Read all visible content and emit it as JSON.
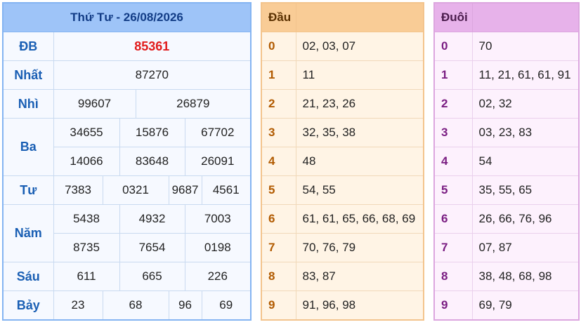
{
  "results": {
    "title": "Thứ Tư - 26/08/2026",
    "prizes": [
      {
        "label": "ĐB",
        "numbers": [
          "85361"
        ]
      },
      {
        "label": "Nhất",
        "numbers": [
          "87270"
        ]
      },
      {
        "label": "Nhì",
        "numbers": [
          "99607",
          "26879"
        ]
      },
      {
        "label": "Ba",
        "numbers": [
          "34655",
          "15876",
          "67702",
          "14066",
          "83648",
          "26091"
        ]
      },
      {
        "label": "Tư",
        "numbers": [
          "7383",
          "0321",
          "9687",
          "4561"
        ]
      },
      {
        "label": "Năm",
        "numbers": [
          "5438",
          "4932",
          "7003",
          "8735",
          "7654",
          "0198"
        ]
      },
      {
        "label": "Sáu",
        "numbers": [
          "611",
          "665",
          "226"
        ]
      },
      {
        "label": "Bảy",
        "numbers": [
          "23",
          "68",
          "96",
          "69"
        ]
      }
    ]
  },
  "dau": {
    "header": "Đầu",
    "rows": [
      {
        "digit": "0",
        "values": "02, 03, 07"
      },
      {
        "digit": "1",
        "values": "11"
      },
      {
        "digit": "2",
        "values": "21, 23, 26"
      },
      {
        "digit": "3",
        "values": "32, 35, 38"
      },
      {
        "digit": "4",
        "values": "48"
      },
      {
        "digit": "5",
        "values": "54, 55"
      },
      {
        "digit": "6",
        "values": "61, 61, 65, 66, 68, 69"
      },
      {
        "digit": "7",
        "values": "70, 76, 79"
      },
      {
        "digit": "8",
        "values": "83, 87"
      },
      {
        "digit": "9",
        "values": "91, 96, 98"
      }
    ]
  },
  "duoi": {
    "header": "Đuôi",
    "rows": [
      {
        "digit": "0",
        "values": "70"
      },
      {
        "digit": "1",
        "values": "11, 21, 61, 61, 91"
      },
      {
        "digit": "2",
        "values": "02, 32"
      },
      {
        "digit": "3",
        "values": "03, 23, 83"
      },
      {
        "digit": "4",
        "values": "54"
      },
      {
        "digit": "5",
        "values": "35, 55, 65"
      },
      {
        "digit": "6",
        "values": "26, 66, 76, 96"
      },
      {
        "digit": "7",
        "values": "07, 87"
      },
      {
        "digit": "8",
        "values": "38, 48, 68, 98"
      },
      {
        "digit": "9",
        "values": "69, 79"
      }
    ]
  },
  "colors": {
    "special_prize": "#e11b1b",
    "results_header": "#9ec4f8",
    "dau_header": "#f9cc96",
    "duoi_header": "#e7b2ea"
  }
}
